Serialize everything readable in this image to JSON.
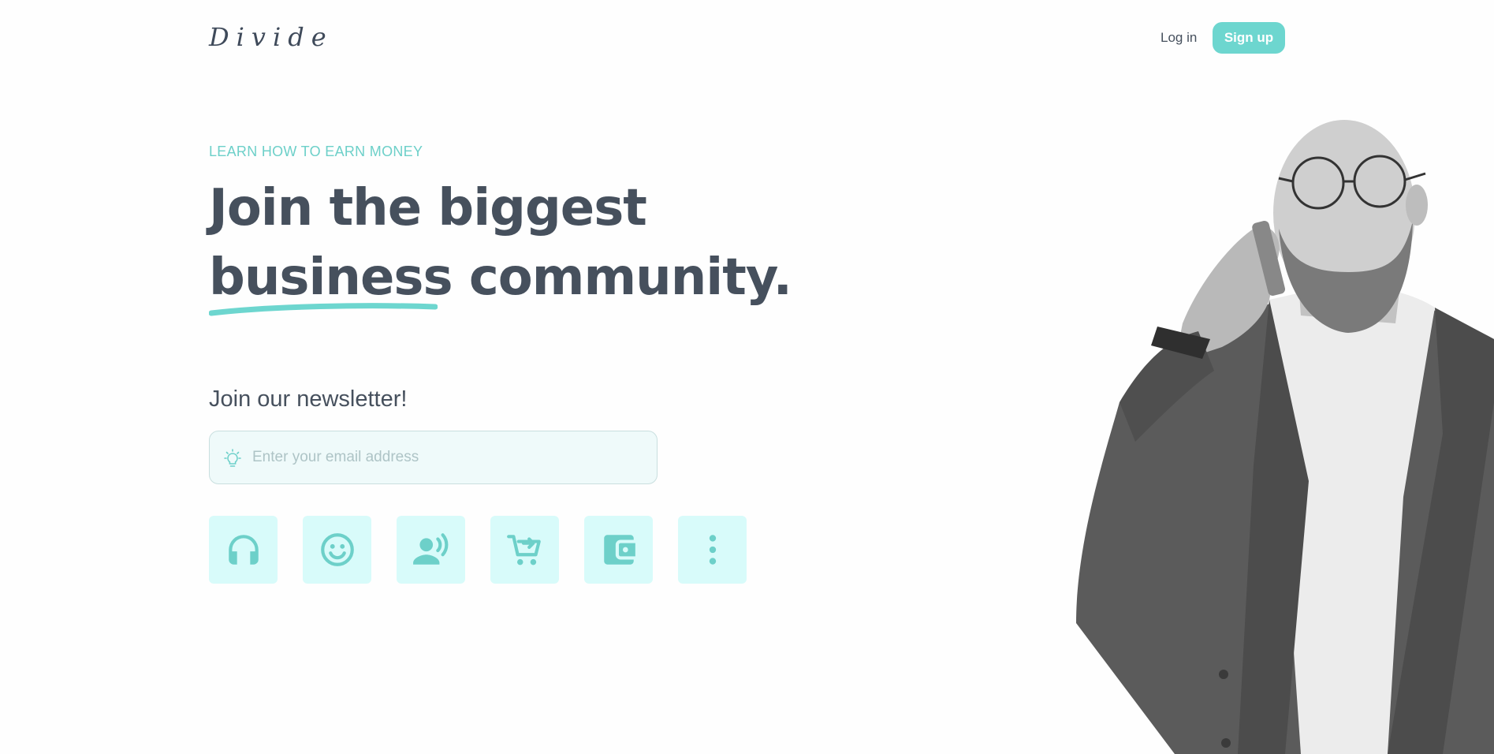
{
  "header": {
    "logo": "Divide",
    "login_label": "Log in",
    "signup_label": "Sign up"
  },
  "hero": {
    "eyebrow": "LEARN HOW TO EARN MONEY",
    "headline_line1": "Join the biggest",
    "headline_word_underlined": "business",
    "headline_line2_rest": " community."
  },
  "newsletter": {
    "title": "Join our newsletter!",
    "email_placeholder": "Enter your email address"
  },
  "icons": [
    {
      "name": "headphones-icon"
    },
    {
      "name": "smiley-icon"
    },
    {
      "name": "voice-user-icon"
    },
    {
      "name": "cart-arrow-icon"
    },
    {
      "name": "wallet-icon"
    },
    {
      "name": "more-vertical-icon"
    }
  ],
  "colors": {
    "accent": "#6dd6cf",
    "text": "#46505d",
    "tile_bg": "#d8fbfa",
    "input_bg": "#effafa"
  }
}
